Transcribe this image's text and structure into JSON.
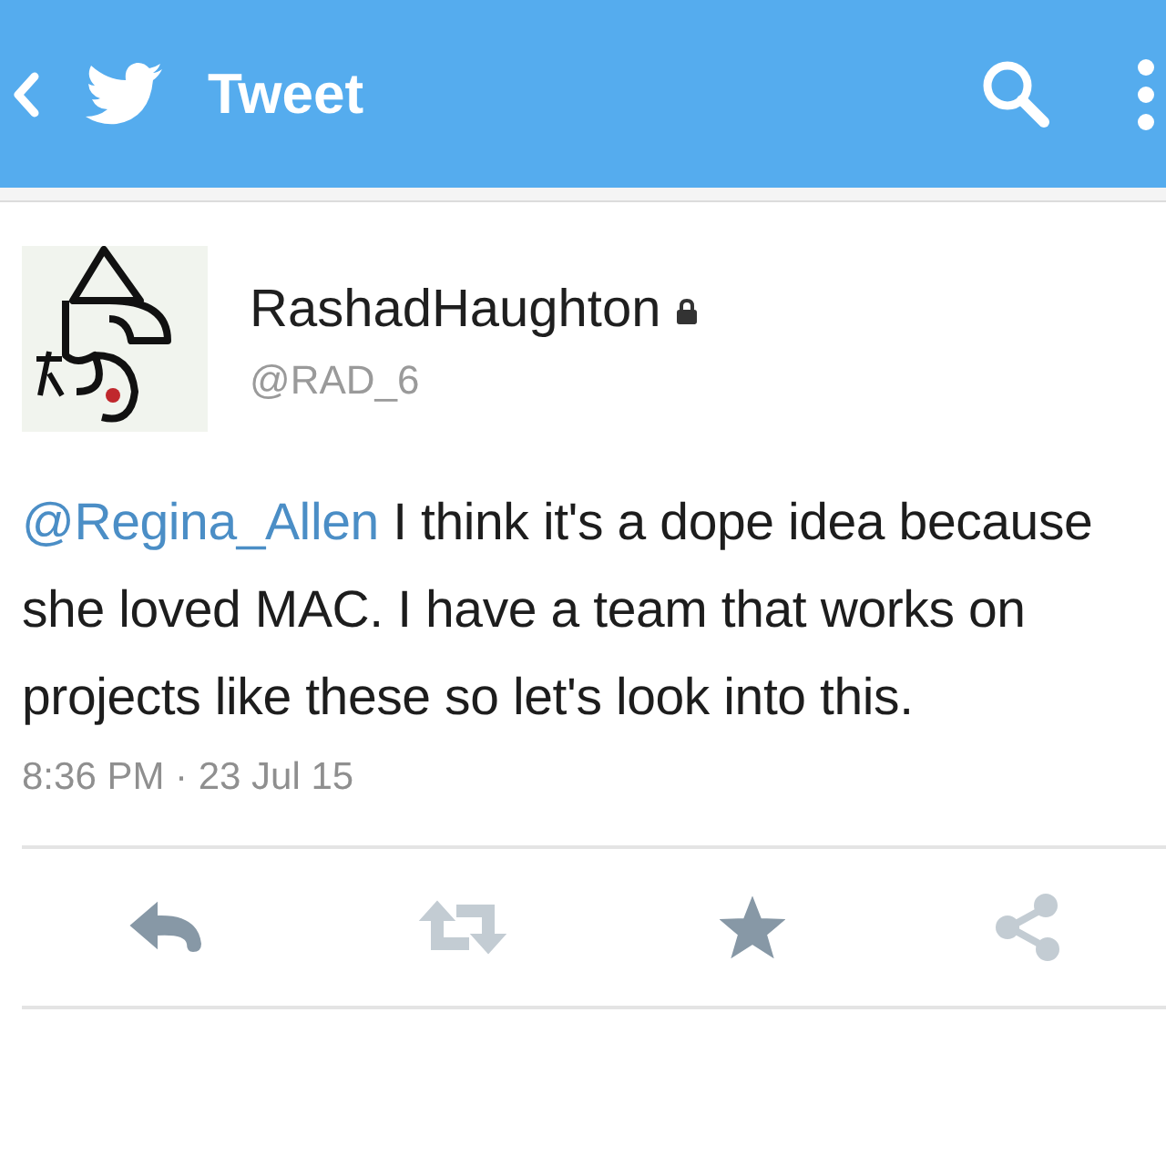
{
  "app_bar": {
    "title": "Tweet"
  },
  "tweet": {
    "author_name": "RashadHaughton",
    "protected": true,
    "handle": "@RAD_6",
    "mention": "@Regina_Allen",
    "text": " I think it's a dope idea because she loved MAC.  I have a team that works on projects like these so let's look into this.",
    "timestamp": "8:36 PM · 23 Jul 15"
  },
  "actions": [
    {
      "kind": "reply",
      "disabled": false
    },
    {
      "kind": "retweet",
      "disabled": true
    },
    {
      "kind": "favorite",
      "disabled": false
    },
    {
      "kind": "share",
      "disabled": true
    }
  ]
}
